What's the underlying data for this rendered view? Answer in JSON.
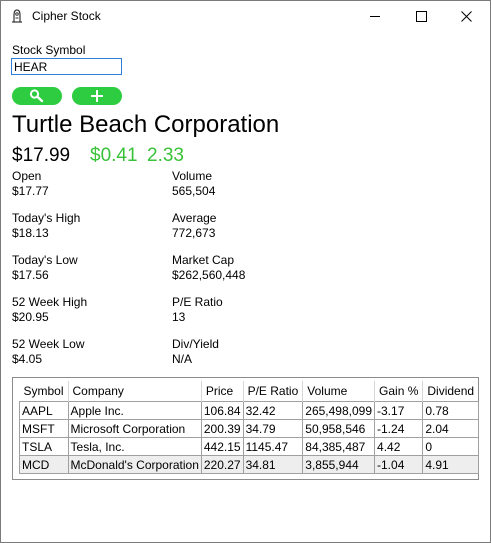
{
  "window": {
    "title": "Cipher Stock"
  },
  "form": {
    "symbol_label": "Stock Symbol",
    "symbol_value": "HEAR"
  },
  "quote": {
    "company": "Turtle Beach Corporation",
    "price": "$17.99",
    "change": "$0.41",
    "change_percent": "2.33",
    "stats": {
      "open": {
        "label": "Open",
        "value": "$17.77"
      },
      "high": {
        "label": "Today's High",
        "value": "$18.13"
      },
      "low": {
        "label": "Today's Low",
        "value": "$17.56"
      },
      "week52_high": {
        "label": "52 Week High",
        "value": "$20.95"
      },
      "week52_low": {
        "label": "52 Week Low",
        "value": "$4.05"
      },
      "volume": {
        "label": "Volume",
        "value": "565,504"
      },
      "average": {
        "label": "Average",
        "value": "772,673"
      },
      "market_cap": {
        "label": "Market Cap",
        "value": "$262,560,448"
      },
      "pe_ratio": {
        "label": "P/E Ratio",
        "value": "13"
      },
      "div_yield": {
        "label": "Div/Yield",
        "value": "N/A"
      }
    }
  },
  "colors": {
    "accent_green": "#2ecc40",
    "change_green": "#39c239",
    "input_border": "#2f7fd8"
  },
  "icons": {
    "app": "person-icon",
    "search": "search-icon",
    "add": "plus-icon",
    "minimize": "minimize-icon",
    "maximize": "maximize-icon",
    "close": "close-icon"
  },
  "watchlist": {
    "columns": [
      "Symbol",
      "Company",
      "Price",
      "P/E Ratio",
      "Volume",
      "Gain %",
      "Dividend"
    ],
    "rows": [
      [
        "AAPL",
        "Apple Inc.",
        "106.84",
        "32.42",
        "265,498,099",
        "-3.17",
        "0.78"
      ],
      [
        "MSFT",
        "Microsoft Corporation",
        "200.39",
        "34.79",
        "50,958,546",
        "-1.24",
        "2.04"
      ],
      [
        "TSLA",
        "Tesla, Inc.",
        "442.15",
        "1145.47",
        "84,385,487",
        "4.42",
        "0"
      ],
      [
        "MCD",
        "McDonald's Corporation",
        "220.27",
        "34.81",
        "3,855,944",
        "-1.04",
        "4.91"
      ]
    ]
  }
}
